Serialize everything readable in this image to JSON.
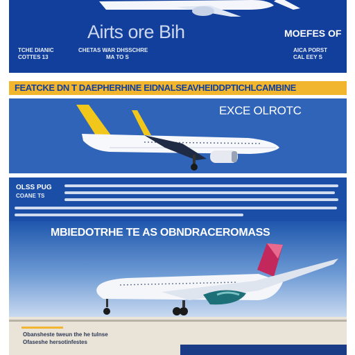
{
  "poster": {
    "top": {
      "title": "Airts ore Bih",
      "right_title": "MOEFES OF",
      "left_caption_1": "TCHE DIANIC",
      "left_caption_2": "COTTES 13",
      "center_caption_1": "CHETAS WAR DHSSCHRE",
      "center_caption_2": "MA TO S",
      "right_caption_1": "AICA PORST",
      "right_caption_2": "CAL EEY S"
    },
    "strip": {
      "text": "FEATCKE DN T DAEPHERHINE EIDNALSEAVHEIDDPTICHLCAMBINE"
    },
    "panel1": {
      "heading": "EXCE OLROTC"
    },
    "info": {
      "heading": "OLSS PUG",
      "sub": "COANE TS"
    },
    "panel2": {
      "heading": "MBIEDOTRHE TE AS OBNDRACEROMASS"
    },
    "footer": {
      "line_1": "Obansheste tweun the he tulnse",
      "line_2": "Ofaseshe hersotinfestes"
    },
    "colors": {
      "navy": "#123f9b",
      "yellow": "#f2b52e",
      "tail_pink": "#c2285c",
      "tail_yellow": "#f2c71b"
    },
    "icons": [
      "airplane-icon",
      "airplane-icon",
      "airplane-icon"
    ]
  }
}
